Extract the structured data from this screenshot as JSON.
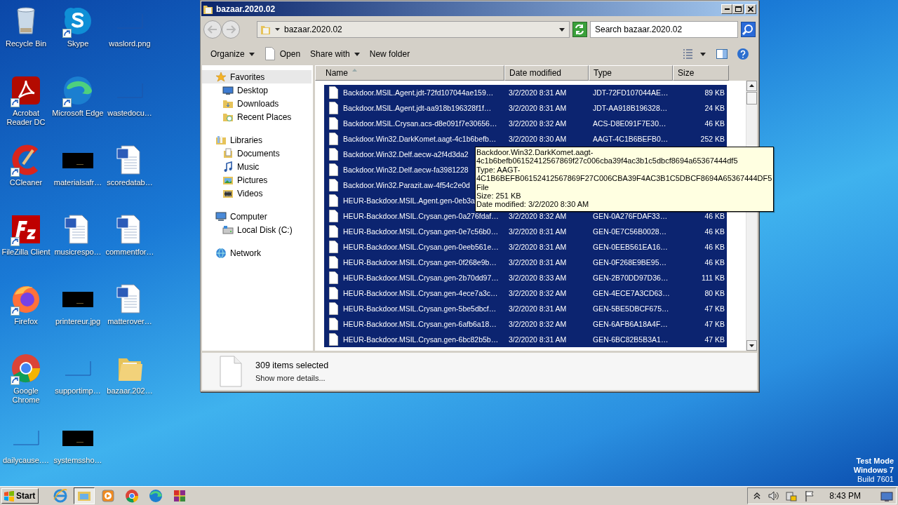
{
  "desktop_icons": [
    {
      "label": "Recycle Bin",
      "kind": "recycle",
      "shortcut": false
    },
    {
      "label": "Acrobat Reader DC",
      "kind": "acrobat",
      "shortcut": true
    },
    {
      "label": "CCleaner",
      "kind": "ccleaner",
      "shortcut": true
    },
    {
      "label": "FileZilla Client",
      "kind": "filezilla",
      "shortcut": true
    },
    {
      "label": "Firefox",
      "kind": "firefox",
      "shortcut": true
    },
    {
      "label": "Google Chrome",
      "kind": "chrome",
      "shortcut": true
    },
    {
      "label": "dailycause.…",
      "kind": "blank",
      "shortcut": false
    },
    {
      "label": "Skype",
      "kind": "skype",
      "shortcut": true
    },
    {
      "label": "Microsoft Edge",
      "kind": "edge",
      "shortcut": true
    },
    {
      "label": "materialsafr…",
      "kind": "dark",
      "shortcut": false
    },
    {
      "label": "musicrespo…",
      "kind": "word",
      "shortcut": false
    },
    {
      "label": "printereur.jpg",
      "kind": "dark",
      "shortcut": false
    },
    {
      "label": "supportimp…",
      "kind": "blank",
      "shortcut": false
    },
    {
      "label": "systemssho…",
      "kind": "dark",
      "shortcut": false
    },
    {
      "label": "waslord.png",
      "kind": "blank",
      "shortcut": false
    },
    {
      "label": "wastedocu…",
      "kind": "blank",
      "shortcut": false
    },
    {
      "label": "scoredatab…",
      "kind": "word",
      "shortcut": false
    },
    {
      "label": "commentfor…",
      "kind": "word",
      "shortcut": false
    },
    {
      "label": "matterover…",
      "kind": "word",
      "shortcut": false
    },
    {
      "label": "bazaar.202…",
      "kind": "folder",
      "shortcut": false
    }
  ],
  "window": {
    "title": "bazaar.2020.02",
    "address": "bazaar.2020.02",
    "search": {
      "placeholder": "Search bazaar.2020.02"
    },
    "toolbar": [
      {
        "label": "Organize",
        "kind": "menu"
      },
      {
        "label": "Open",
        "kind": "open"
      },
      {
        "label": "Share with",
        "kind": "menu"
      },
      {
        "label": "New folder",
        "kind": "plain"
      }
    ],
    "nav": [
      {
        "label": "Favorites",
        "selected": true,
        "children": [
          {
            "label": "Desktop",
            "selected": false
          },
          {
            "label": "Downloads",
            "selected": false
          },
          {
            "label": "Recent Places",
            "selected": false
          }
        ]
      },
      {
        "label": "Libraries",
        "selected": false,
        "children": [
          {
            "label": "Documents",
            "selected": false
          },
          {
            "label": "Music",
            "selected": false
          },
          {
            "label": "Pictures",
            "selected": false
          },
          {
            "label": "Videos",
            "selected": false
          }
        ]
      },
      {
        "label": "Computer",
        "selected": false,
        "children": [
          {
            "label": "Local Disk (C:)",
            "selected": false
          }
        ]
      },
      {
        "label": "Network",
        "selected": false
      }
    ],
    "columns": [
      {
        "label": "Name",
        "sorted": true
      },
      {
        "label": "Date modified",
        "sorted": false
      },
      {
        "label": "Type",
        "sorted": false
      },
      {
        "label": "Size",
        "sorted": false
      }
    ],
    "rows": [
      {
        "name": "Backdoor.MSIL.Agent.jdt-72fd107044ae159…",
        "date": "3/2/2020 8:31 AM",
        "type": "JDT-72FD107044AE…",
        "size": "89 KB",
        "selected": true
      },
      {
        "name": "Backdoor.MSIL.Agent.jdt-aa918b196328f1f…",
        "date": "3/2/2020 8:31 AM",
        "type": "JDT-AA918B196328…",
        "size": "24 KB",
        "selected": true
      },
      {
        "name": "Backdoor.MSIL.Crysan.acs-d8e091f7e30656…",
        "date": "3/2/2020 8:32 AM",
        "type": "ACS-D8E091F7E30…",
        "size": "46 KB",
        "selected": true
      },
      {
        "name": "Backdoor.Win32.DarkKomet.aagt-4c1b6befb…",
        "date": "3/2/2020 8:30 AM",
        "type": "AAGT-4C1B6BEFB0…",
        "size": "252 KB",
        "selected": true
      },
      {
        "name": "Backdoor.Win32.Delf.aecw-a2f4d3da2",
        "selected": true
      },
      {
        "name": "Backdoor.Win32.Delf.aecw-fa3981228",
        "selected": true
      },
      {
        "name": "Backdoor.Win32.Parazit.aw-4f54c2e0d",
        "selected": true
      },
      {
        "name": "HEUR-Backdoor.MSIL.Agent.gen-0eb3a",
        "selected": true
      },
      {
        "name": "HEUR-Backdoor.MSIL.Crysan.gen-0a276fdaf…",
        "date": "3/2/2020 8:32 AM",
        "type": "GEN-0A276FDAF33…",
        "size": "46 KB",
        "selected": true
      },
      {
        "name": "HEUR-Backdoor.MSIL.Crysan.gen-0e7c56b0…",
        "date": "3/2/2020 8:31 AM",
        "type": "GEN-0E7C56B0028…",
        "size": "46 KB",
        "selected": true
      },
      {
        "name": "HEUR-Backdoor.MSIL.Crysan.gen-0eeb561e…",
        "date": "3/2/2020 8:31 AM",
        "type": "GEN-0EEB561EA16…",
        "size": "46 KB",
        "selected": true
      },
      {
        "name": "HEUR-Backdoor.MSIL.Crysan.gen-0f268e9b…",
        "date": "3/2/2020 8:31 AM",
        "type": "GEN-0F268E9BE95…",
        "size": "46 KB",
        "selected": true
      },
      {
        "name": "HEUR-Backdoor.MSIL.Crysan.gen-2b70dd97…",
        "date": "3/2/2020 8:33 AM",
        "type": "GEN-2B70DD97D36…",
        "size": "111 KB",
        "selected": true
      },
      {
        "name": "HEUR-Backdoor.MSIL.Crysan.gen-4ece7a3c…",
        "date": "3/2/2020 8:32 AM",
        "type": "GEN-4ECE7A3CD63…",
        "size": "80 KB",
        "selected": true
      },
      {
        "name": "HEUR-Backdoor.MSIL.Crysan.gen-5be5dbcf…",
        "date": "3/2/2020 8:31 AM",
        "type": "GEN-5BE5DBCF675…",
        "size": "47 KB",
        "selected": true
      },
      {
        "name": "HEUR-Backdoor.MSIL.Crysan.gen-6afb6a18…",
        "date": "3/2/2020 8:32 AM",
        "type": "GEN-6AFB6A18A4F…",
        "size": "47 KB",
        "selected": true
      },
      {
        "name": "HEUR-Backdoor.MSIL.Crysan.gen-6bc82b5b…",
        "date": "3/2/2020 8:31 AM",
        "type": "GEN-6BC82B5B3A1…",
        "size": "47 KB",
        "selected": true
      }
    ],
    "tooltip": {
      "lines": [
        "Backdoor.Win32.DarkKomet.aagt-",
        "4c1b6befb06152412567869f27c006cba39f4ac3b1c5dbcf8694a65367444df5",
        "Type: AAGT-",
        "4C1B6BEFB06152412567869F27C006CBA39F4AC3B1C5DBCF8694A65367444DF5",
        "File",
        "Size: 251 KB",
        "Date modified: 3/2/2020 8:30 AM"
      ]
    },
    "details": {
      "count": "309 items selected",
      "link": "Show more details..."
    }
  },
  "taskbar": {
    "start": "Start",
    "apps": [
      {
        "kind": "ie",
        "active": false
      },
      {
        "kind": "explorer",
        "active": true
      },
      {
        "kind": "media",
        "active": false
      },
      {
        "kind": "chrome",
        "active": false
      },
      {
        "kind": "edge",
        "active": false
      },
      {
        "kind": "winrar",
        "active": false
      }
    ],
    "clock": "8:43 PM"
  },
  "system_text": [
    "Test Mode",
    "Windows 7",
    "Build 7601"
  ]
}
